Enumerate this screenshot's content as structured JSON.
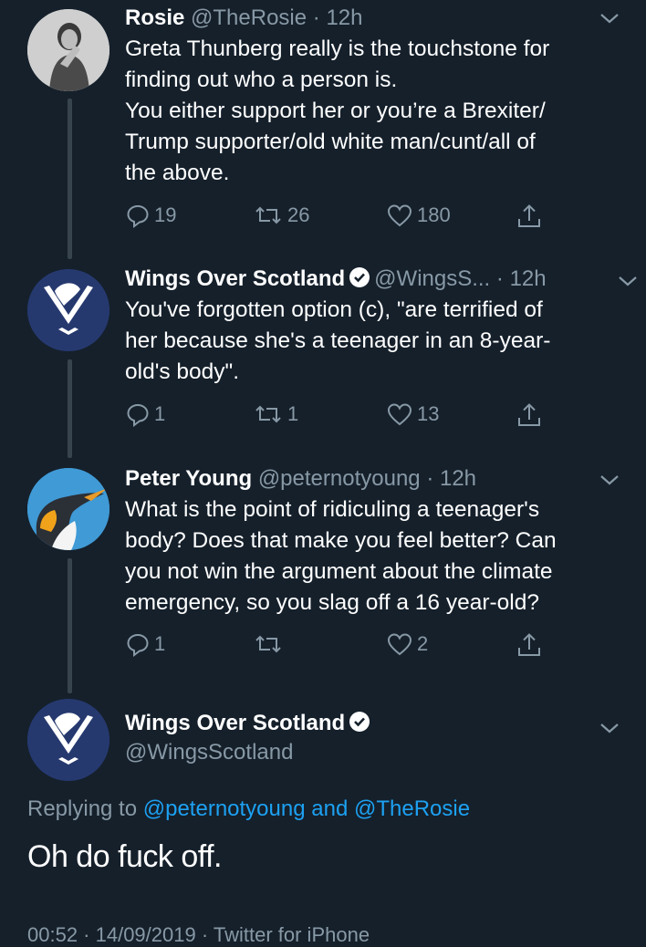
{
  "tweets": [
    {
      "name": "Rosie",
      "handle": "@TheRosie",
      "time": "· 12h",
      "text": [
        "Greta Thunberg really is the touchstone for",
        "finding out who a person is.",
        "You either support her or you’re a Brexiter/",
        "Trump supporter/old white man/cunt/all of",
        "the above."
      ],
      "replies": "19",
      "retweets": "26",
      "likes": "180"
    },
    {
      "name": "Wings Over Scotland",
      "handle": "@WingsS...",
      "time": "· 12h",
      "text": [
        "You've forgotten option (c), \"are terrified of",
        "her because she's a teenager in an 8-year-",
        "old's body\"."
      ],
      "replies": "1",
      "retweets": "1",
      "likes": "13"
    },
    {
      "name": "Peter Young",
      "handle": "@peternotyoung",
      "time": "· 12h",
      "text": [
        "What is the point of ridiculing a teenager's",
        "body? Does that make you feel better? Can",
        "you not win the argument about the climate",
        "emergency, so you slag off a 16 year-old?"
      ],
      "replies": "1",
      "retweets": "",
      "likes": "2"
    }
  ],
  "main_tweet": {
    "name": "Wings Over Scotland",
    "handle": "@WingsScotland",
    "replying_label": "Replying to",
    "replying_user1": "@peternotyoung",
    "replying_and": "and",
    "replying_user2": "@TheRosie",
    "text": "Oh do fuck off.",
    "footer_partial": "00:52 · 14/09/2019 · Twitter for iPhone"
  },
  "colors": {
    "background": "#15202b",
    "secondary_text": "#8899a6",
    "link": "#1da1f2",
    "thread_line": "#38444d"
  }
}
